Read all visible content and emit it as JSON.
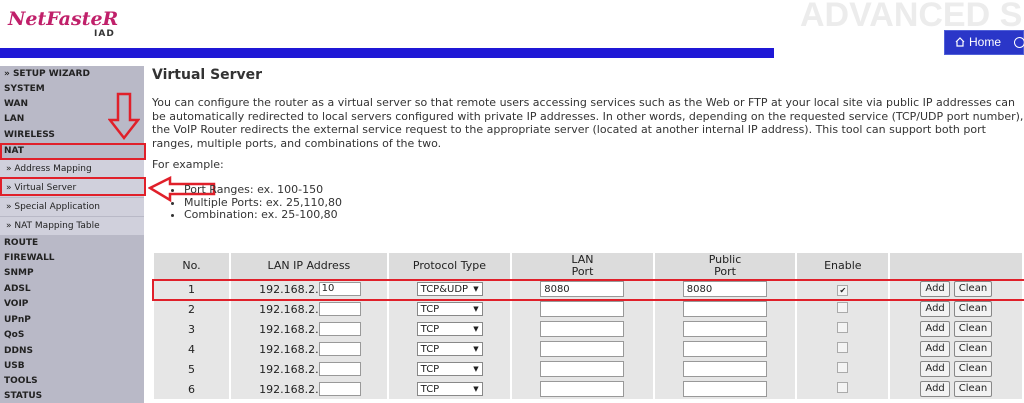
{
  "header": {
    "logo_main": "NetFasteR",
    "logo_sub": "IAD",
    "big_title": "ADVANCED SE",
    "home_label": "Home"
  },
  "sidebar": {
    "items": [
      {
        "label": "» SETUP WIZARD",
        "sub": false
      },
      {
        "label": "SYSTEM",
        "sub": false
      },
      {
        "label": "WAN",
        "sub": false
      },
      {
        "label": "LAN",
        "sub": false
      },
      {
        "label": "WIRELESS",
        "sub": false
      },
      {
        "label": "NAT",
        "sub": false
      },
      {
        "label": "» Address Mapping",
        "sub": true
      },
      {
        "label": "» Virtual Server",
        "sub": true
      },
      {
        "label": "» Special Application",
        "sub": true
      },
      {
        "label": "» NAT Mapping Table",
        "sub": true
      },
      {
        "label": "ROUTE",
        "sub": false
      },
      {
        "label": "FIREWALL",
        "sub": false
      },
      {
        "label": "SNMP",
        "sub": false
      },
      {
        "label": "ADSL",
        "sub": false
      },
      {
        "label": "VOIP",
        "sub": false
      },
      {
        "label": "UPnP",
        "sub": false
      },
      {
        "label": "QoS",
        "sub": false
      },
      {
        "label": "DDNS",
        "sub": false
      },
      {
        "label": "USB",
        "sub": false
      },
      {
        "label": "TOOLS",
        "sub": false
      },
      {
        "label": "STATUS",
        "sub": false
      }
    ]
  },
  "main": {
    "title": "Virtual Server",
    "description": "You can configure the router as a virtual server so that remote users accessing services such as the Web or FTP at your local site via public IP addresses can be automatically redirected to local servers configured with private IP addresses. In other words, depending on the requested service (TCP/UDP port number), the VoIP Router redirects the external service request to the appropriate server (located at another internal IP address). This tool can support both port ranges, multiple ports, and combinations of the two.",
    "example_label": "For example:",
    "examples": [
      "Port Ranges: ex. 100-150",
      "Multiple Ports: ex. 25,110,80",
      "Combination: ex. 25-100,80"
    ]
  },
  "table": {
    "headers": {
      "no": "No.",
      "ip": "LAN IP Address",
      "protocol": "Protocol Type",
      "lan_port_1": "LAN",
      "lan_port_2": "Port",
      "public_port_1": "Public",
      "public_port_2": "Port",
      "enable": "Enable"
    },
    "ip_prefix": "192.168.2.",
    "add_label": "Add",
    "clean_label": "Clean",
    "rows": [
      {
        "no": "1",
        "ip_suffix": "10",
        "protocol": "TCP&UDP",
        "lan_port": "8080",
        "public_port": "8080",
        "enabled": true
      },
      {
        "no": "2",
        "ip_suffix": "",
        "protocol": "TCP",
        "lan_port": "",
        "public_port": "",
        "enabled": false
      },
      {
        "no": "3",
        "ip_suffix": "",
        "protocol": "TCP",
        "lan_port": "",
        "public_port": "",
        "enabled": false
      },
      {
        "no": "4",
        "ip_suffix": "",
        "protocol": "TCP",
        "lan_port": "",
        "public_port": "",
        "enabled": false
      },
      {
        "no": "5",
        "ip_suffix": "",
        "protocol": "TCP",
        "lan_port": "",
        "public_port": "",
        "enabled": false
      },
      {
        "no": "6",
        "ip_suffix": "",
        "protocol": "TCP",
        "lan_port": "",
        "public_port": "",
        "enabled": false
      }
    ]
  },
  "colors": {
    "accent_blue": "#1f18d6",
    "highlight_red": "#e0202a",
    "sidebar_bg": "#b9b9c7",
    "logo_magenta": "#c0206a"
  }
}
